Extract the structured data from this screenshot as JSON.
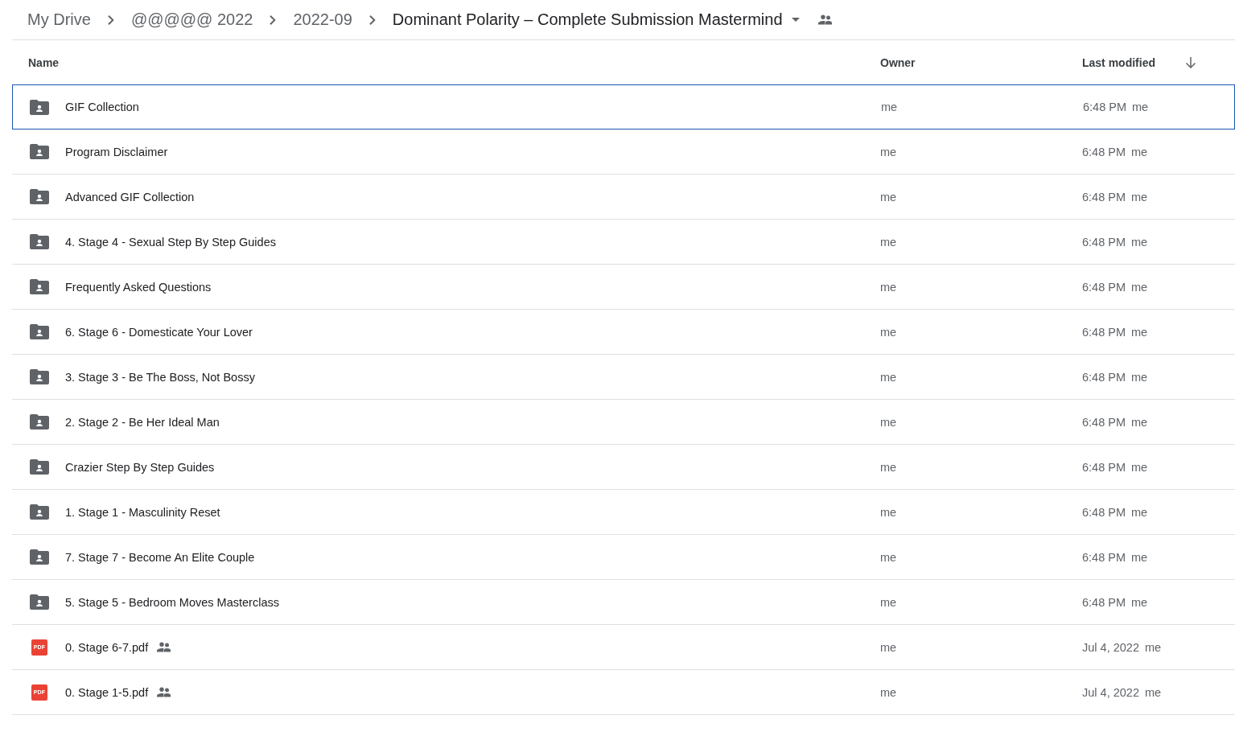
{
  "breadcrumb": [
    {
      "label": "My Drive",
      "current": false
    },
    {
      "label": "@@@@@ 2022",
      "current": false
    },
    {
      "label": "2022-09",
      "current": false
    },
    {
      "label": "Dominant Polarity – Complete Submission Mastermind",
      "current": true
    }
  ],
  "table": {
    "columns": [
      "Name",
      "Owner",
      "Last modified"
    ],
    "rows": [
      {
        "kind": "folder",
        "name": "GIF Collection",
        "shared": false,
        "selected": true,
        "owner": "me",
        "modified": "6:48 PM",
        "modified_by": "me"
      },
      {
        "kind": "folder",
        "name": "Program Disclaimer",
        "shared": false,
        "selected": false,
        "owner": "me",
        "modified": "6:48 PM",
        "modified_by": "me"
      },
      {
        "kind": "folder",
        "name": "Advanced GIF Collection",
        "shared": false,
        "selected": false,
        "owner": "me",
        "modified": "6:48 PM",
        "modified_by": "me"
      },
      {
        "kind": "folder",
        "name": "4. Stage 4 - Sexual Step By Step Guides",
        "shared": false,
        "selected": false,
        "owner": "me",
        "modified": "6:48 PM",
        "modified_by": "me"
      },
      {
        "kind": "folder",
        "name": "Frequently Asked Questions",
        "shared": false,
        "selected": false,
        "owner": "me",
        "modified": "6:48 PM",
        "modified_by": "me"
      },
      {
        "kind": "folder",
        "name": "6. Stage 6 - Domesticate Your Lover",
        "shared": false,
        "selected": false,
        "owner": "me",
        "modified": "6:48 PM",
        "modified_by": "me"
      },
      {
        "kind": "folder",
        "name": "3. Stage 3 - Be The Boss, Not Bossy",
        "shared": false,
        "selected": false,
        "owner": "me",
        "modified": "6:48 PM",
        "modified_by": "me"
      },
      {
        "kind": "folder",
        "name": "2. Stage 2 - Be Her Ideal Man",
        "shared": false,
        "selected": false,
        "owner": "me",
        "modified": "6:48 PM",
        "modified_by": "me"
      },
      {
        "kind": "folder",
        "name": "Crazier Step By Step Guides",
        "shared": false,
        "selected": false,
        "owner": "me",
        "modified": "6:48 PM",
        "modified_by": "me"
      },
      {
        "kind": "folder",
        "name": "1. Stage 1 - Masculinity Reset",
        "shared": false,
        "selected": false,
        "owner": "me",
        "modified": "6:48 PM",
        "modified_by": "me"
      },
      {
        "kind": "folder",
        "name": "7. Stage 7 - Become An Elite Couple",
        "shared": false,
        "selected": false,
        "owner": "me",
        "modified": "6:48 PM",
        "modified_by": "me"
      },
      {
        "kind": "folder",
        "name": "5. Stage 5 - Bedroom Moves Masterclass",
        "shared": false,
        "selected": false,
        "owner": "me",
        "modified": "6:48 PM",
        "modified_by": "me"
      },
      {
        "kind": "pdf",
        "badge": "PDF",
        "name": "0. Stage 6-7.pdf",
        "shared": true,
        "selected": false,
        "owner": "me",
        "modified": "Jul 4, 2022",
        "modified_by": "me"
      },
      {
        "kind": "pdf",
        "badge": "PDF",
        "name": "0. Stage 1-5.pdf",
        "shared": true,
        "selected": false,
        "owner": "me",
        "modified": "Jul 4, 2022",
        "modified_by": "me"
      }
    ]
  }
}
